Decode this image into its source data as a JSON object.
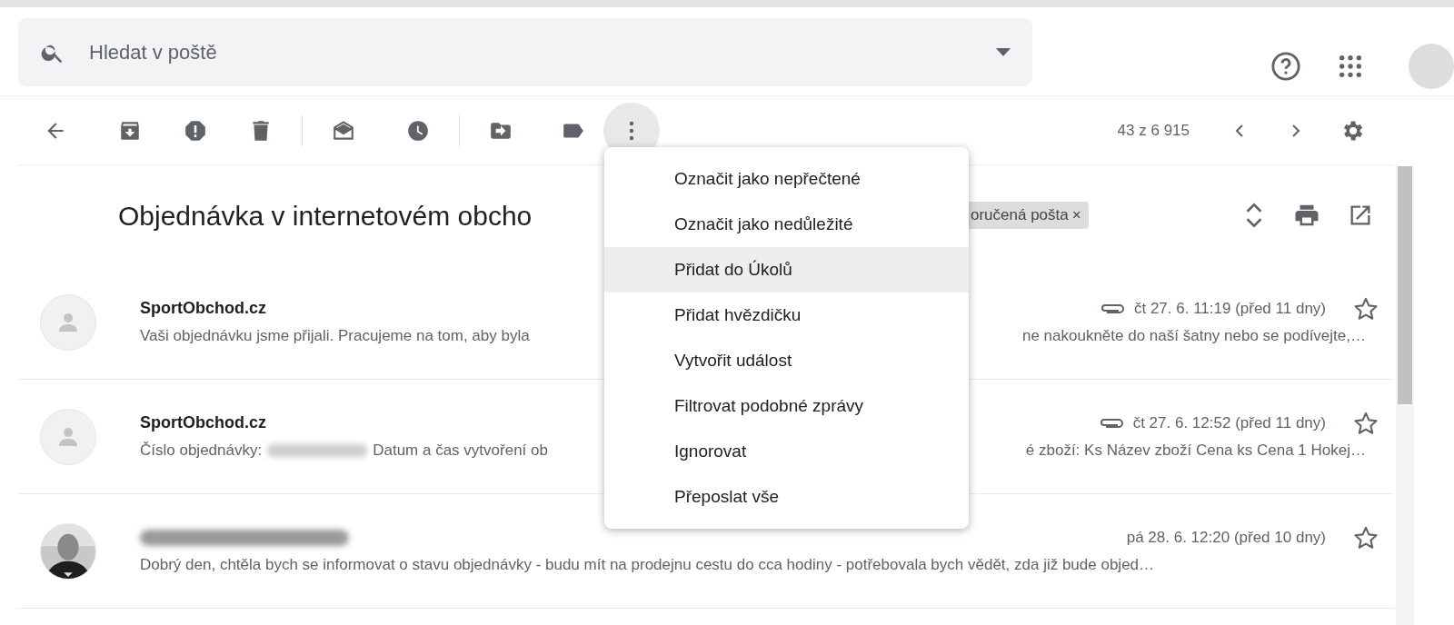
{
  "search": {
    "placeholder": "Hledat v poště"
  },
  "toolbar": {
    "counter": "43 z 6 915"
  },
  "more_menu": {
    "open": true,
    "items": [
      {
        "label": "Označit jako nepřečtené",
        "selected": false
      },
      {
        "label": "Označit jako nedůležité",
        "selected": false
      },
      {
        "label": "Přidat do Úkolů",
        "selected": true
      },
      {
        "label": "Přidat hvězdičku",
        "selected": false
      },
      {
        "label": "Vytvořit událost",
        "selected": false
      },
      {
        "label": "Filtrovat podobné zprávy",
        "selected": false
      },
      {
        "label": "Ignorovat",
        "selected": false
      },
      {
        "label": "Přeposlat vše",
        "selected": false
      }
    ]
  },
  "thread": {
    "subject": "Objednávka v internetovém obcho",
    "label_chip": "oručená pošta",
    "chip_close": "×"
  },
  "messages": [
    {
      "sender": {
        "kind": "text",
        "text": "SportObchod.cz"
      },
      "avatar": {
        "kind": "placeholder"
      },
      "attachment": true,
      "date": "čt 27. 6. 11:19 (před 11 dny)",
      "starred": false,
      "preview": [
        {
          "kind": "text",
          "text": "Vaši objednávku jsme přijali. Pracujeme na tom, aby byla"
        },
        {
          "kind": "covered"
        },
        {
          "kind": "text",
          "text": "ne nakoukněte do naší šatny nebo se podívejte,…"
        }
      ]
    },
    {
      "sender": {
        "kind": "text",
        "text": "SportObchod.cz"
      },
      "avatar": {
        "kind": "placeholder"
      },
      "attachment": true,
      "date": "čt 27. 6. 12:52 (před 11 dny)",
      "starred": false,
      "preview": [
        {
          "kind": "text",
          "text": "Číslo objednávky:"
        },
        {
          "kind": "redacted"
        },
        {
          "kind": "text",
          "text": "Datum a čas vytvoření ob"
        },
        {
          "kind": "covered"
        },
        {
          "kind": "text",
          "text": "é zboží: Ks Název zboží Cena ks Cena 1 Hokej…"
        }
      ]
    },
    {
      "sender": {
        "kind": "redacted"
      },
      "attachment": false,
      "date": "pá 28. 6. 12:20 (před 10 dny)",
      "starred": false,
      "preview": [
        {
          "kind": "text",
          "text": "Dobrý den, chtěla bych se informovat o stavu objednávky - budu mít na prodejnu cestu do cca hodiny - potřebovala bych vědět, zda již bude objed…"
        }
      ]
    }
  ]
}
